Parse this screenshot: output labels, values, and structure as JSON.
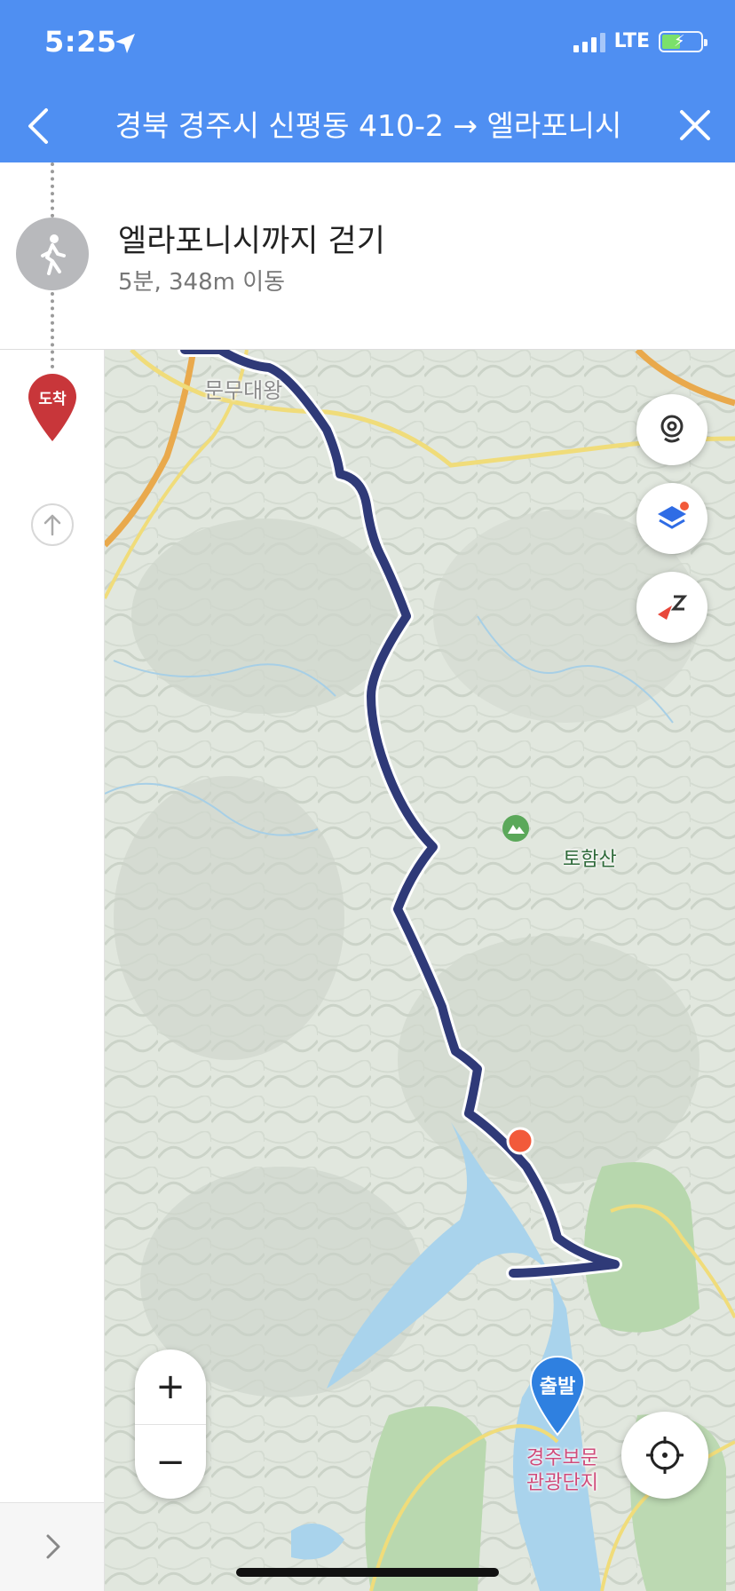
{
  "status_bar": {
    "time": "5:25",
    "network": "LTE",
    "icons": [
      "location-arrow-icon",
      "signal-icon",
      "battery-charging-icon"
    ]
  },
  "header": {
    "title": "경북 경주시 신평동 410-2 → 엘라포니시",
    "back_icon": "chevron-left-icon",
    "close_icon": "close-icon",
    "background": "#4f8ff2"
  },
  "step": {
    "title": "엘라포니시까지 걷기",
    "subtitle": "5분, 348m 이동",
    "icon": "walking-icon"
  },
  "rail": {
    "arrive_label": "도착",
    "arrive_color": "#c8363a"
  },
  "map": {
    "labels": {
      "town": "문무대왕",
      "mountain": "토함산",
      "resort_line1": "경주보문",
      "resort_line2": "관광단지",
      "start": "출발"
    },
    "route_color": "#2f3a78",
    "zoom_in": "+",
    "zoom_out": "−",
    "controls": [
      "street-view-icon",
      "layers-icon",
      "compass-icon",
      "my-location-icon"
    ]
  }
}
